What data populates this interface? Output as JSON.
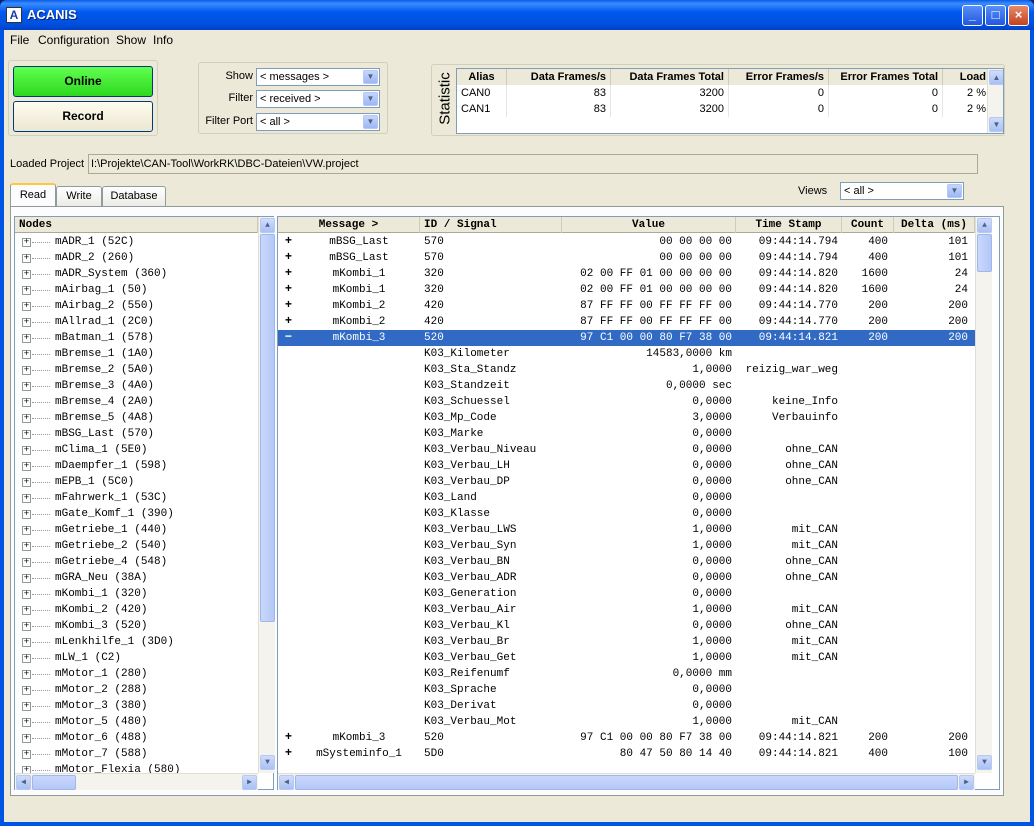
{
  "window": {
    "title": "ACANIS",
    "icon": "A"
  },
  "menu": [
    "File",
    "Configuration",
    "Show",
    "Info"
  ],
  "buttons": {
    "online": "Online",
    "record": "Record"
  },
  "filters": {
    "show_label": "Show",
    "show_value": "< messages >",
    "filter_label": "Filter",
    "filter_value": "< received >",
    "port_label": "Filter Port",
    "port_value": "< all >"
  },
  "statistic": {
    "label": "Statistic",
    "headers": [
      "Alias",
      "Data Frames/s",
      "Data Frames Total",
      "Error Frames/s",
      "Error Frames Total",
      "Load"
    ],
    "rows": [
      [
        "CAN0",
        "83",
        "3200",
        "0",
        "0",
        "2 %"
      ],
      [
        "CAN1",
        "83",
        "3200",
        "0",
        "0",
        "2 %"
      ]
    ]
  },
  "project": {
    "label": "Loaded Project",
    "path": "I:\\Projekte\\CAN-Tool\\WorkRK\\DBC-Dateien\\VW.project"
  },
  "tabs": [
    "Read",
    "Write",
    "Database"
  ],
  "views": {
    "label": "Views",
    "value": "< all >"
  },
  "nodes": {
    "header": "Nodes",
    "items": [
      "mADR_1 (52C)",
      "mADR_2 (260)",
      "mADR_System (360)",
      "mAirbag_1 (50)",
      "mAirbag_2 (550)",
      "mAllrad_1 (2C0)",
      "mBatman_1 (578)",
      "mBremse_1 (1A0)",
      "mBremse_2 (5A0)",
      "mBremse_3 (4A0)",
      "mBremse_4 (2A0)",
      "mBremse_5 (4A8)",
      "mBSG_Last (570)",
      "mClima_1 (5E0)",
      "mDaempfer_1 (598)",
      "mEPB_1 (5C0)",
      "mFahrwerk_1 (53C)",
      "mGate_Komf_1 (390)",
      "mGetriebe_1 (440)",
      "mGetriebe_2 (540)",
      "mGetriebe_4 (548)",
      "mGRA_Neu (38A)",
      "mKombi_1 (320)",
      "mKombi_2 (420)",
      "mKombi_3 (520)",
      "mLenkhilfe_1 (3D0)",
      "mLW_1 (C2)",
      "mMotor_1 (280)",
      "mMotor_2 (288)",
      "mMotor_3 (380)",
      "mMotor_5 (480)",
      "mMotor_6 (488)",
      "mMotor_7 (588)",
      "mMotor_Flexia (580)"
    ]
  },
  "messages": {
    "headers": [
      "Message >",
      "ID / Signal",
      "Value",
      "Time Stamp",
      "Count",
      "Delta (ms)"
    ],
    "rows": [
      {
        "mark": "+",
        "msg": "mBSG_Last",
        "id": "570",
        "value": "00 00 00 00",
        "time": "09:44:14.794",
        "count": "400",
        "delta": "101"
      },
      {
        "mark": "+",
        "msg": "mBSG_Last",
        "id": "570",
        "value": "00 00 00 00",
        "time": "09:44:14.794",
        "count": "400",
        "delta": "101"
      },
      {
        "mark": "+",
        "msg": "mKombi_1",
        "id": "320",
        "value": "02 00 FF 01 00 00 00 00",
        "time": "09:44:14.820",
        "count": "1600",
        "delta": "24"
      },
      {
        "mark": "+",
        "msg": "mKombi_1",
        "id": "320",
        "value": "02 00 FF 01 00 00 00 00",
        "time": "09:44:14.820",
        "count": "1600",
        "delta": "24"
      },
      {
        "mark": "+",
        "msg": "mKombi_2",
        "id": "420",
        "value": "87 FF FF 00 FF FF FF 00",
        "time": "09:44:14.770",
        "count": "200",
        "delta": "200"
      },
      {
        "mark": "+",
        "msg": "mKombi_2",
        "id": "420",
        "value": "87 FF FF 00 FF FF FF 00",
        "time": "09:44:14.770",
        "count": "200",
        "delta": "200"
      },
      {
        "mark": "−",
        "msg": "mKombi_3",
        "id": "520",
        "value": "97 C1 00 00 80 F7 38 00",
        "time": "09:44:14.821",
        "count": "200",
        "delta": "200",
        "selected": true
      },
      {
        "mark": "",
        "msg": "",
        "id": "K03_Kilometer",
        "value": "14583,0000 km",
        "time": "",
        "count": "",
        "delta": ""
      },
      {
        "mark": "",
        "msg": "",
        "id": "K03_Sta_Standz",
        "value": "1,0000",
        "time": "reizig_war_weg",
        "count": "",
        "delta": ""
      },
      {
        "mark": "",
        "msg": "",
        "id": "K03_Standzeit",
        "value": "0,0000 sec",
        "time": "",
        "count": "",
        "delta": ""
      },
      {
        "mark": "",
        "msg": "",
        "id": "K03_Schuessel",
        "value": "0,0000",
        "time": "keine_Info",
        "count": "",
        "delta": ""
      },
      {
        "mark": "",
        "msg": "",
        "id": "K03_Mp_Code",
        "value": "3,0000",
        "time": "Verbauinfo",
        "count": "",
        "delta": ""
      },
      {
        "mark": "",
        "msg": "",
        "id": "K03_Marke",
        "value": "0,0000",
        "time": "",
        "count": "",
        "delta": ""
      },
      {
        "mark": "",
        "msg": "",
        "id": "K03_Verbau_Niveau",
        "value": "0,0000",
        "time": "ohne_CAN",
        "count": "",
        "delta": ""
      },
      {
        "mark": "",
        "msg": "",
        "id": "K03_Verbau_LH",
        "value": "0,0000",
        "time": "ohne_CAN",
        "count": "",
        "delta": ""
      },
      {
        "mark": "",
        "msg": "",
        "id": "K03_Verbau_DP",
        "value": "0,0000",
        "time": "ohne_CAN",
        "count": "",
        "delta": ""
      },
      {
        "mark": "",
        "msg": "",
        "id": "K03_Land",
        "value": "0,0000",
        "time": "",
        "count": "",
        "delta": ""
      },
      {
        "mark": "",
        "msg": "",
        "id": "K03_Klasse",
        "value": "0,0000",
        "time": "",
        "count": "",
        "delta": ""
      },
      {
        "mark": "",
        "msg": "",
        "id": "K03_Verbau_LWS",
        "value": "1,0000",
        "time": "mit_CAN",
        "count": "",
        "delta": ""
      },
      {
        "mark": "",
        "msg": "",
        "id": "K03_Verbau_Syn",
        "value": "1,0000",
        "time": "mit_CAN",
        "count": "",
        "delta": ""
      },
      {
        "mark": "",
        "msg": "",
        "id": "K03_Verbau_BN",
        "value": "0,0000",
        "time": "ohne_CAN",
        "count": "",
        "delta": ""
      },
      {
        "mark": "",
        "msg": "",
        "id": "K03_Verbau_ADR",
        "value": "0,0000",
        "time": "ohne_CAN",
        "count": "",
        "delta": ""
      },
      {
        "mark": "",
        "msg": "",
        "id": "K03_Generation",
        "value": "0,0000",
        "time": "",
        "count": "",
        "delta": ""
      },
      {
        "mark": "",
        "msg": "",
        "id": "K03_Verbau_Air",
        "value": "1,0000",
        "time": "mit_CAN",
        "count": "",
        "delta": ""
      },
      {
        "mark": "",
        "msg": "",
        "id": "K03_Verbau_Kl",
        "value": "0,0000",
        "time": "ohne_CAN",
        "count": "",
        "delta": ""
      },
      {
        "mark": "",
        "msg": "",
        "id": "K03_Verbau_Br",
        "value": "1,0000",
        "time": "mit_CAN",
        "count": "",
        "delta": ""
      },
      {
        "mark": "",
        "msg": "",
        "id": "K03_Verbau_Get",
        "value": "1,0000",
        "time": "mit_CAN",
        "count": "",
        "delta": ""
      },
      {
        "mark": "",
        "msg": "",
        "id": "K03_Reifenumf",
        "value": "0,0000 mm",
        "time": "",
        "count": "",
        "delta": ""
      },
      {
        "mark": "",
        "msg": "",
        "id": "K03_Sprache",
        "value": "0,0000",
        "time": "",
        "count": "",
        "delta": ""
      },
      {
        "mark": "",
        "msg": "",
        "id": "K03_Derivat",
        "value": "0,0000",
        "time": "",
        "count": "",
        "delta": ""
      },
      {
        "mark": "",
        "msg": "",
        "id": "K03_Verbau_Mot",
        "value": "1,0000",
        "time": "mit_CAN",
        "count": "",
        "delta": ""
      },
      {
        "mark": "+",
        "msg": "mKombi_3",
        "id": "520",
        "value": "97 C1 00 00 80 F7 38 00",
        "time": "09:44:14.821",
        "count": "200",
        "delta": "200"
      },
      {
        "mark": "+",
        "msg": "mSysteminfo_1",
        "id": "5D0",
        "value": "80 47 50 80 14 40",
        "time": "09:44:14.821",
        "count": "400",
        "delta": "100"
      }
    ]
  },
  "colors": {
    "selection": "#316ac5",
    "online_green": "#3ee82e",
    "titlebar_blue": "#0054e3"
  }
}
